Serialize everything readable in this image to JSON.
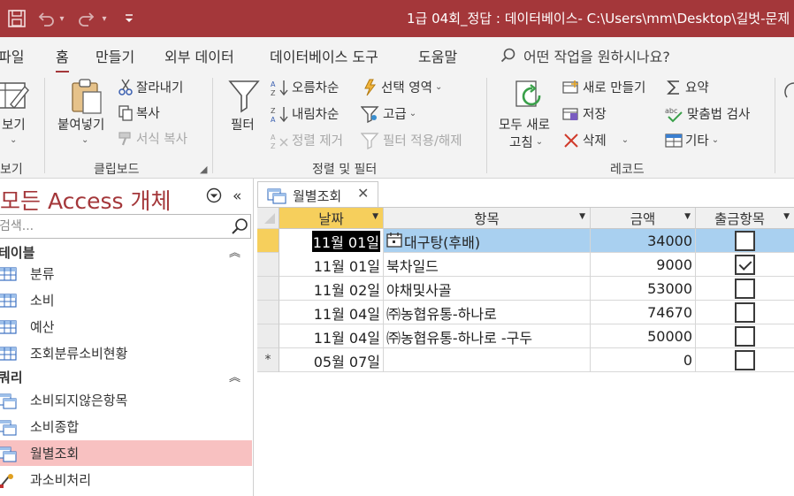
{
  "titlebar": {
    "title": "1급 04회_정답 : 데이터베이스- C:\\Users\\mm\\Desktop\\길벗-문제",
    "undo_icon": "undo-icon",
    "redo_icon": "redo-icon",
    "save_icon": "save-icon",
    "customize_icon": "customize-qat-icon"
  },
  "tabs": [
    "파일",
    "홈",
    "만들기",
    "외부 데이터",
    "데이터베이스 도구",
    "도움말"
  ],
  "tell_me": "어떤 작업을 원하시나요?",
  "ribbon": {
    "views": {
      "view_label": "보기",
      "group": "보기"
    },
    "clipboard": {
      "paste": "붙여넣기",
      "cut": "잘라내기",
      "copy": "복사",
      "format_painter": "서식 복사",
      "group": "클립보드"
    },
    "sort_filter": {
      "filter": "필터",
      "ascending": "오름차순",
      "descending": "내림차순",
      "remove_sort": "정렬 제거",
      "selection": "선택 영역",
      "advanced": "고급",
      "toggle_filter": "필터 적용/해제",
      "group": "정렬 및 필터"
    },
    "records": {
      "refresh_line1": "모두 새로",
      "refresh_line2": "고침",
      "new": "새로 만들기",
      "save": "저장",
      "delete": "삭제",
      "totals": "요약",
      "spelling": "맞춤법 검사",
      "more": "기타",
      "group": "레코드"
    }
  },
  "nav": {
    "title": "모든 Access 개체",
    "search_placeholder": "검색...",
    "tables_header": "테이블",
    "tables": [
      "분류",
      "소비",
      "예산",
      "조회분류소비현황"
    ],
    "queries_header": "쿼리",
    "queries": [
      "소비되지않은항목",
      "소비종합",
      "월별조회",
      "과소비처리"
    ],
    "selected": "월별조회"
  },
  "document": {
    "tab_label": "월별조회",
    "columns": [
      "날짜",
      "항목",
      "금액",
      "출금항목"
    ],
    "rows": [
      {
        "date": "11월 01일",
        "item": "대구탕(후배)",
        "amount": "34000",
        "checked": false
      },
      {
        "date": "11월 01일",
        "item": "북차일드",
        "amount": "9000",
        "checked": true
      },
      {
        "date": "11월 02일",
        "item": "야채및사골",
        "amount": "53000",
        "checked": false
      },
      {
        "date": "11월 04일",
        "item": "㈜농협유통-하나로",
        "amount": "74670",
        "checked": false
      },
      {
        "date": "11월 04일",
        "item": "㈜농협유통-하나로 -구두",
        "amount": "50000",
        "checked": false
      }
    ],
    "new_row": {
      "marker": "*",
      "date": "05월 07일",
      "amount": "0",
      "checked": false
    }
  },
  "colors": {
    "accent": "#a4373a",
    "selected_row": "#a9d0f0",
    "active_header": "#f6cf5c",
    "nav_selected": "#f8c1c1"
  }
}
